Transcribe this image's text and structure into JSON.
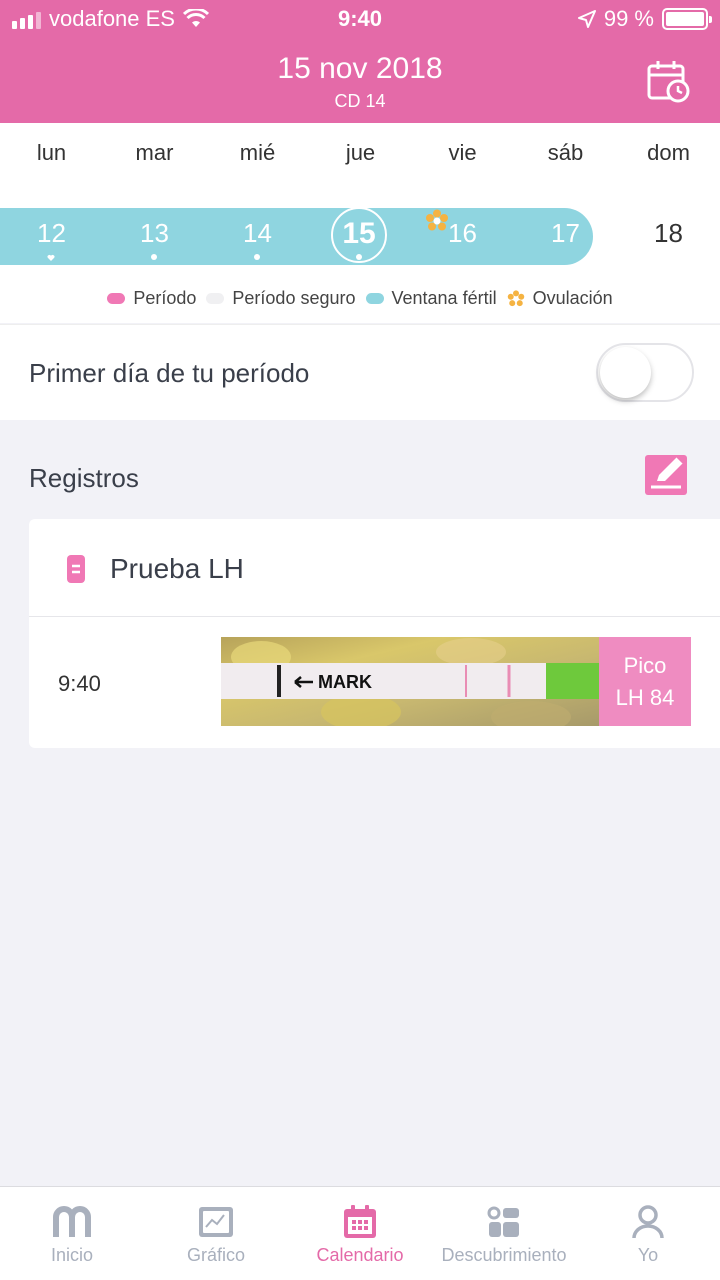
{
  "status_bar": {
    "carrier": "vodafone ES",
    "time": "9:40",
    "battery": "99 %"
  },
  "header": {
    "title": "15 nov 2018",
    "subtitle": "CD 14",
    "calendar_icon": "calendar-clock-icon"
  },
  "week": {
    "days": [
      "lun",
      "mar",
      "mié",
      "jue",
      "vie",
      "sáb",
      "dom"
    ],
    "dates": [
      "12",
      "13",
      "14",
      "15",
      "16",
      "17",
      "18"
    ],
    "selected": "15"
  },
  "legend": {
    "period": "Período",
    "safe": "Período seguro",
    "fertile": "Ventana fértil",
    "ovulation": "Ovulación"
  },
  "toggle": {
    "label": "Primer día de tu período",
    "on": false
  },
  "records": {
    "title": "Registros",
    "card_title": "Prueba LH",
    "entry_time": "9:40",
    "badge_line1": "Pico",
    "badge_line2": "LH 84",
    "strip_text": "MARK"
  },
  "nav": {
    "items": [
      {
        "label": "Inicio",
        "icon": "home-arch-icon"
      },
      {
        "label": "Gráfico",
        "icon": "chart-icon"
      },
      {
        "label": "Calendario",
        "icon": "calendar-icon"
      },
      {
        "label": "Descubrimiento",
        "icon": "discover-icon"
      },
      {
        "label": "Yo",
        "icon": "profile-icon"
      }
    ],
    "active": "Calendario"
  },
  "colors": {
    "brand_pink": "#e46aa8",
    "fertile_blue": "#8fd5e0",
    "ovulation_orange": "#f5b342",
    "badge_pink": "#ef8cc1"
  }
}
